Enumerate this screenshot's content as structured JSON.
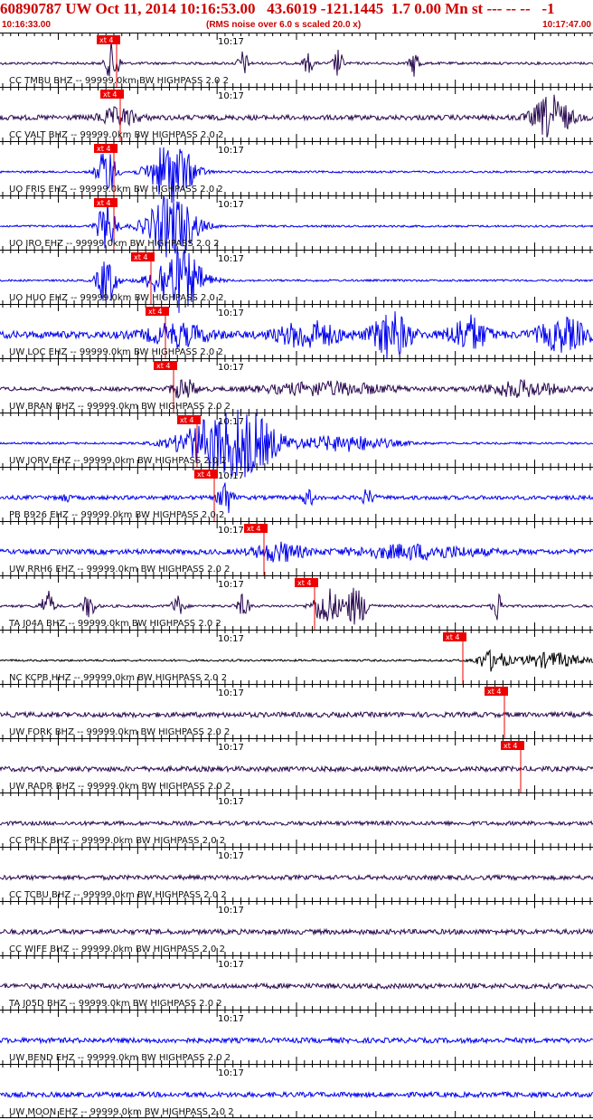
{
  "header": {
    "title": "60890787 UW Oct 11, 2014 10:16:53.00   43.6019 -121.1445  1.7 0.00 Mn st --- -- --   -1",
    "start_time": "10:16:33.00",
    "scale_note": "(RMS noise over 6.0 s scaled 20.0 x)",
    "end_time": "10:17:47.00",
    "title_color": "#cc0000"
  },
  "panel": {
    "minute_label": "10:17",
    "pick_label": "xt 4"
  },
  "colors": {
    "blue": "#0000ee",
    "purple": "#2a0a50",
    "black": "#000000",
    "pick": "#ee0000",
    "axis": "#000000"
  },
  "traces": [
    {
      "label": "CC TMBU BHZ -- 99999.0km BW  HIGHPASS  2.0  2",
      "color": "purple",
      "pick_frac": 0.196,
      "noise": 0.05,
      "bursts": [
        {
          "at": 0.19,
          "amp": 0.9,
          "w": 0.01
        },
        {
          "at": 0.41,
          "amp": 0.5,
          "w": 0.008
        },
        {
          "at": 0.52,
          "amp": 0.4,
          "w": 0.008
        },
        {
          "at": 0.57,
          "amp": 0.55,
          "w": 0.008
        },
        {
          "at": 0.7,
          "amp": 0.55,
          "w": 0.008
        }
      ]
    },
    {
      "label": "CC VALT BHZ -- 99999.0km BW  HIGHPASS  2.0  2",
      "color": "purple",
      "pick_frac": 0.202,
      "noise": 0.1,
      "bursts": [
        {
          "at": 0.2,
          "amp": 0.35,
          "w": 0.03
        },
        {
          "at": 0.93,
          "amp": 0.85,
          "w": 0.03
        }
      ]
    },
    {
      "label": "UO FRIS EHZ -- 99999.0km BW  HIGHPASS  2.0  2",
      "color": "blue",
      "pick_frac": 0.192,
      "noise": 0.04,
      "bursts": [
        {
          "at": 0.18,
          "amp": 1.0,
          "w": 0.015
        },
        {
          "at": 0.29,
          "amp": 1.3,
          "w": 0.035
        }
      ]
    },
    {
      "label": "UO IRO EHZ -- 99999.0km BW  HIGHPASS  2.0  2",
      "color": "blue",
      "pick_frac": 0.192,
      "noise": 0.04,
      "bursts": [
        {
          "at": 0.18,
          "amp": 1.0,
          "w": 0.015
        },
        {
          "at": 0.29,
          "amp": 1.3,
          "w": 0.04
        }
      ]
    },
    {
      "label": "UO HUO EHZ -- 99999.0km BW  HIGHPASS  2.0  2",
      "color": "blue",
      "pick_frac": 0.255,
      "noise": 0.04,
      "bursts": [
        {
          "at": 0.18,
          "amp": 1.0,
          "w": 0.015
        },
        {
          "at": 0.3,
          "amp": 1.3,
          "w": 0.04
        }
      ]
    },
    {
      "label": "UW LOC EHZ -- 99999.0km BW  HIGHPASS  2.0  2",
      "color": "blue",
      "pick_frac": 0.279,
      "noise": 0.14,
      "bursts": [
        {
          "at": 0.3,
          "amp": 0.4,
          "w": 0.05
        },
        {
          "at": 0.52,
          "amp": 0.5,
          "w": 0.05
        },
        {
          "at": 0.66,
          "amp": 0.9,
          "w": 0.03
        },
        {
          "at": 0.79,
          "amp": 0.7,
          "w": 0.03
        },
        {
          "at": 0.95,
          "amp": 0.6,
          "w": 0.04
        }
      ]
    },
    {
      "label": "UW BRAN BHZ -- 99999.0km BW  HIGHPASS  2.0  2",
      "color": "purple",
      "pick_frac": 0.292,
      "noise": 0.08,
      "bursts": [
        {
          "at": 0.31,
          "amp": 0.4,
          "w": 0.02
        },
        {
          "at": 0.55,
          "amp": 0.25,
          "w": 0.1
        },
        {
          "at": 0.88,
          "amp": 0.3,
          "w": 0.06
        }
      ]
    },
    {
      "label": "UW JORV EHZ -- 99999.0km BW  HIGHPASS  2.0  2",
      "color": "blue",
      "pick_frac": 0.333,
      "noise": 0.04,
      "bursts": [
        {
          "at": 0.36,
          "amp": 0.9,
          "w": 0.06
        },
        {
          "at": 0.42,
          "amp": 1.0,
          "w": 0.05
        },
        {
          "at": 0.58,
          "amp": 0.3,
          "w": 0.08
        }
      ]
    },
    {
      "label": "PB B926 EHZ -- 99999.0km BW  HIGHPASS  2.0  2",
      "color": "blue",
      "pick_frac": 0.362,
      "noise": 0.08,
      "bursts": [
        {
          "at": 0.11,
          "amp": 0.3,
          "w": 0.005
        },
        {
          "at": 0.38,
          "amp": 0.8,
          "w": 0.01
        },
        {
          "at": 0.52,
          "amp": 0.3,
          "w": 0.01
        },
        {
          "at": 0.62,
          "amp": 0.3,
          "w": 0.01
        }
      ]
    },
    {
      "label": "UW RRH6 EHZ -- 99999.0km BW  HIGHPASS  2.0  2",
      "color": "blue",
      "pick_frac": 0.445,
      "noise": 0.1,
      "bursts": [
        {
          "at": 0.47,
          "amp": 0.35,
          "w": 0.04
        },
        {
          "at": 0.7,
          "amp": 0.25,
          "w": 0.1
        }
      ]
    },
    {
      "label": "TA J04A BHZ -- 99999.0km BW  HIGHPASS  2.0  2",
      "color": "purple",
      "pick_frac": 0.531,
      "noise": 0.05,
      "bursts": [
        {
          "at": 0.08,
          "amp": 0.6,
          "w": 0.01
        },
        {
          "at": 0.15,
          "amp": 0.5,
          "w": 0.01
        },
        {
          "at": 0.3,
          "amp": 0.4,
          "w": 0.01
        },
        {
          "at": 0.41,
          "amp": 0.45,
          "w": 0.01
        },
        {
          "at": 0.55,
          "amp": 0.8,
          "w": 0.02
        },
        {
          "at": 0.6,
          "amp": 0.75,
          "w": 0.02
        },
        {
          "at": 0.84,
          "amp": 0.6,
          "w": 0.008
        }
      ]
    },
    {
      "label": "NC KCPB HHZ -- 99999.0km BW  HIGHPASS  2.0  2",
      "color": "black",
      "pick_frac": 0.78,
      "noise": 0.04,
      "bursts": [
        {
          "at": 0.83,
          "amp": 0.4,
          "w": 0.025
        },
        {
          "at": 0.93,
          "amp": 0.3,
          "w": 0.05
        }
      ]
    },
    {
      "label": "UW FORK BHZ -- 99999.0km BW  HIGHPASS  2.0  2",
      "color": "purple",
      "pick_frac": 0.85,
      "noise": 0.1,
      "bursts": []
    },
    {
      "label": "UW RADR BHZ -- 99999.0km BW  HIGHPASS  2.0  2",
      "color": "purple",
      "pick_frac": 0.878,
      "noise": 0.1,
      "bursts": []
    },
    {
      "label": "CC PRLK BHZ -- 99999.0km BW  HIGHPASS  2.0  2",
      "color": "purple",
      "pick_frac": null,
      "noise": 0.08,
      "bursts": []
    },
    {
      "label": "CC TCBU BHZ -- 99999.0km BW  HIGHPASS  2.0  2",
      "color": "purple",
      "pick_frac": null,
      "noise": 0.09,
      "bursts": []
    },
    {
      "label": "CC WIFE BHZ -- 99999.0km BW  HIGHPASS  2.0  2",
      "color": "purple",
      "pick_frac": null,
      "noise": 0.1,
      "bursts": []
    },
    {
      "label": "TA J05D BHZ -- 99999.0km BW  HIGHPASS  2.0  2",
      "color": "purple",
      "pick_frac": null,
      "noise": 0.1,
      "bursts": []
    },
    {
      "label": "UW BEND EHZ -- 99999.0km BW  HIGHPASS  2.0  2",
      "color": "blue",
      "pick_frac": null,
      "noise": 0.1,
      "bursts": []
    },
    {
      "label": "UW MOON EHZ -- 99999.0km BW  HIGHPASS  2.0  2",
      "color": "blue",
      "pick_frac": null,
      "noise": 0.1,
      "bursts": []
    }
  ]
}
